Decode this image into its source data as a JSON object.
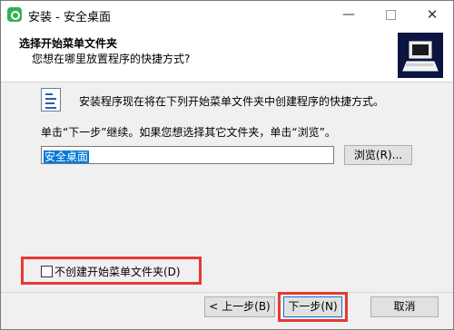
{
  "window": {
    "title": "安装 - 安全桌面",
    "controls": {
      "minimize": "—",
      "close": "✕"
    }
  },
  "header": {
    "title": "选择开始菜单文件夹",
    "subtitle": "您想在哪里放置程序的快捷方式?"
  },
  "content": {
    "info": "安装程序现在将在下列开始菜单文件夹中创建程序的快捷方式。",
    "hint": "单击“下一步”继续。如果您想选择其它文件夹，单击“浏览”。",
    "folder_value": "安全桌面",
    "browse_label": "浏览(R)...",
    "no_folder_checkbox": {
      "label": "不创建开始菜单文件夹(D)",
      "checked": false
    }
  },
  "buttons": {
    "back": "< 上一步(B)",
    "next": "下一步(N)",
    "cancel": "取消"
  },
  "colors": {
    "highlight": "#e53935",
    "selection": "#0078d7"
  }
}
